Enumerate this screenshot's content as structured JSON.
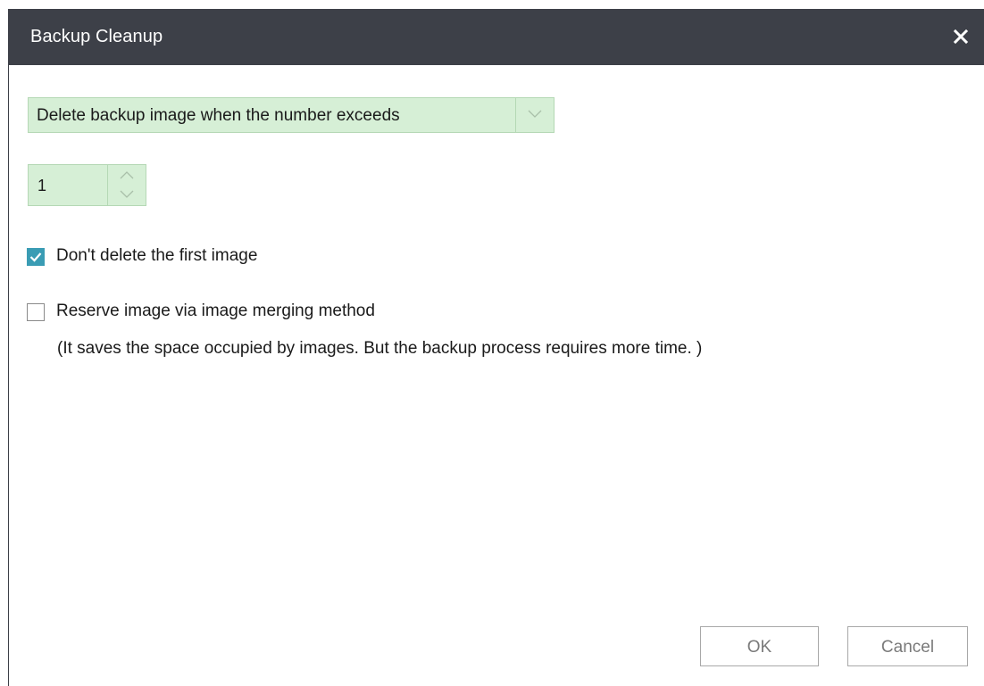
{
  "dialog": {
    "title": "Backup Cleanup",
    "close_icon": "close-icon"
  },
  "cleanup_mode": {
    "selected": "Delete backup image when the number exceeds",
    "arrow_icon": "chevron-down-icon"
  },
  "image_count": {
    "value": "1",
    "up_icon": "chevron-up-icon",
    "down_icon": "chevron-down-icon"
  },
  "keep_first": {
    "label": "Don't delete the first image",
    "checked": true
  },
  "merge_images": {
    "label": "Reserve image via image merging method",
    "note": "(It saves the space occupied by images. But the backup process requires more time. )",
    "checked": false
  },
  "buttons": {
    "ok_label": "OK",
    "cancel_label": "Cancel"
  },
  "colors": {
    "titlebar": "#3d4048",
    "field_bg": "#d6efd6",
    "checkbox_accent": "#3a9cb4"
  }
}
